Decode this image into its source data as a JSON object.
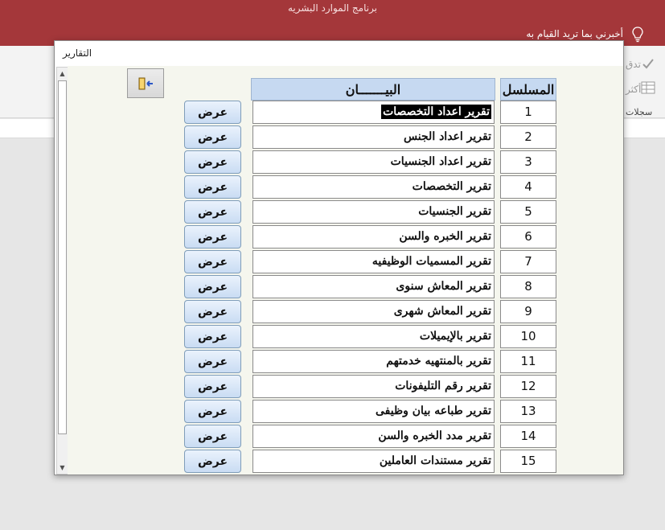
{
  "app": {
    "title": "برنامج الموارد البشريه",
    "tell_me": "أخبرني بما تريد القيام به",
    "ribbon_frag_1": "تدق",
    "ribbon_frag_2": "أكثر",
    "ribbon_frag_3": "سجلات"
  },
  "dialog": {
    "title": "التقارير"
  },
  "table": {
    "header_description": "البيـــــــان",
    "header_serial": "المسلسل",
    "view_label": "عرض",
    "rows": [
      {
        "serial": "1",
        "description": "تقرير اعداد التخصصات",
        "selected": true
      },
      {
        "serial": "2",
        "description": "تقرير اعداد الجنس"
      },
      {
        "serial": "3",
        "description": "تقرير اعداد الجنسيات"
      },
      {
        "serial": "4",
        "description": "تقرير التخصصات"
      },
      {
        "serial": "5",
        "description": "تقرير الجنسيات"
      },
      {
        "serial": "6",
        "description": "تقرير الخبره والسن"
      },
      {
        "serial": "7",
        "description": "تقرير المسميات الوظيفيه"
      },
      {
        "serial": "8",
        "description": "تقرير المعاش سنوى"
      },
      {
        "serial": "9",
        "description": "تقرير المعاش شهرى"
      },
      {
        "serial": "10",
        "description": "تقرير بالإيميلات"
      },
      {
        "serial": "11",
        "description": "تقرير بالمنتهيه خدمتهم"
      },
      {
        "serial": "12",
        "description": "تقرير رقم التليفونات"
      },
      {
        "serial": "13",
        "description": "تقرير طباعه بيان وظيفى"
      },
      {
        "serial": "14",
        "description": "تقرير مدد الخبره والسن"
      },
      {
        "serial": "15",
        "description": "تقرير مستندات العاملين"
      }
    ]
  },
  "icons": {
    "bulb": "lightbulb-icon",
    "exit": "exit-door-icon",
    "scroll_up": "scroll-up-arrow-icon",
    "scroll_down": "scroll-down-arrow-icon"
  },
  "colors": {
    "titlebar": "#a4373a",
    "header_bg": "#c6d9f1",
    "form_bg": "#f5f6ee",
    "selection": "#000000"
  }
}
